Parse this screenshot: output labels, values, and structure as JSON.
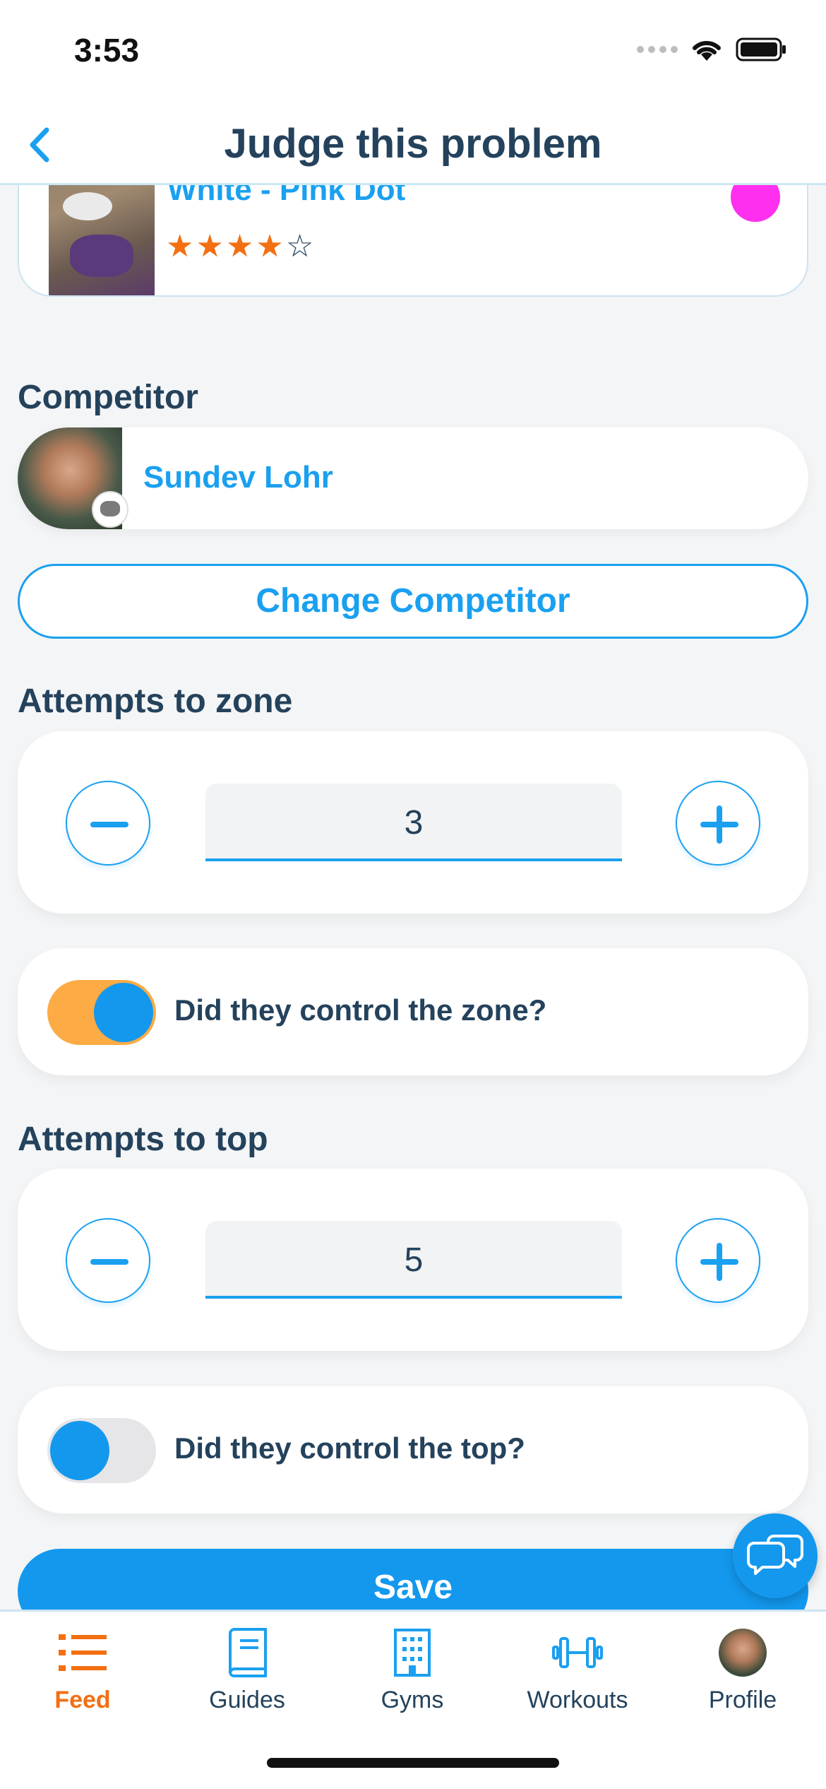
{
  "status_bar": {
    "time": "3:53"
  },
  "nav": {
    "title": "Judge this problem"
  },
  "problem": {
    "name": "White - Pink Dot",
    "rating": 4,
    "max_rating": 5,
    "dot_color": "#ff2ff0"
  },
  "competitor": {
    "section_label": "Competitor",
    "name": "Sundev Lohr",
    "change_label": "Change Competitor"
  },
  "zone": {
    "section_label": "Attempts to zone",
    "attempts": "3",
    "control_label": "Did they control the zone?",
    "controlled": true
  },
  "top": {
    "section_label": "Attempts to top",
    "attempts": "5",
    "control_label": "Did they control the top?",
    "controlled": false
  },
  "save_label": "Save",
  "tabs": [
    {
      "label": "Feed",
      "icon": "list-icon",
      "active": true
    },
    {
      "label": "Guides",
      "icon": "book-icon",
      "active": false
    },
    {
      "label": "Gyms",
      "icon": "building-icon",
      "active": false
    },
    {
      "label": "Workouts",
      "icon": "dumbbell-icon",
      "active": false
    },
    {
      "label": "Profile",
      "icon": "avatar",
      "active": false
    }
  ],
  "colors": {
    "accent": "#1aa0f0",
    "active_tab": "#f36f12",
    "toggle_on_track": "#fcab45",
    "heading": "#24425c"
  }
}
